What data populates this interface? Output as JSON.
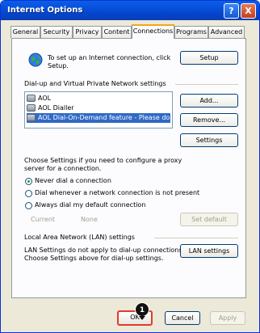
{
  "window": {
    "title": "Internet Options",
    "help_glyph": "?",
    "close_glyph": "X"
  },
  "tabs": [
    "General",
    "Security",
    "Privacy",
    "Content",
    "Connections",
    "Programs",
    "Advanced"
  ],
  "active_tab": "Connections",
  "setup": {
    "text_line1": "To set up an Internet connection, click",
    "text_line2": "Setup.",
    "button": "Setup"
  },
  "dialup": {
    "heading": "Dial-up and Virtual Private Network settings",
    "connections": [
      "AOL",
      "AOL Dialler",
      "AOL Dial-On-Demand feature - Please do NOT"
    ],
    "selected_index": 2,
    "add_button": "Add...",
    "remove_button": "Remove...",
    "settings_button": "Settings",
    "proxy_line1": "Choose Settings if you need to configure a proxy",
    "proxy_line2": "server for a connection.",
    "radios": [
      "Never dial a connection",
      "Dial whenever a network connection is not present",
      "Always dial my default connection"
    ],
    "selected_radio": 0,
    "current_label": "Current",
    "current_value": "None",
    "set_default_button": "Set default"
  },
  "lan": {
    "heading": "Local Area Network (LAN) settings",
    "text_line1": "LAN Settings do not apply to dial-up connections.",
    "text_line2": "Choose Settings above for dial-up settings.",
    "button": "LAN settings"
  },
  "footer": {
    "ok": "OK",
    "cancel": "Cancel",
    "apply": "Apply"
  },
  "annotation": {
    "step": "1"
  }
}
